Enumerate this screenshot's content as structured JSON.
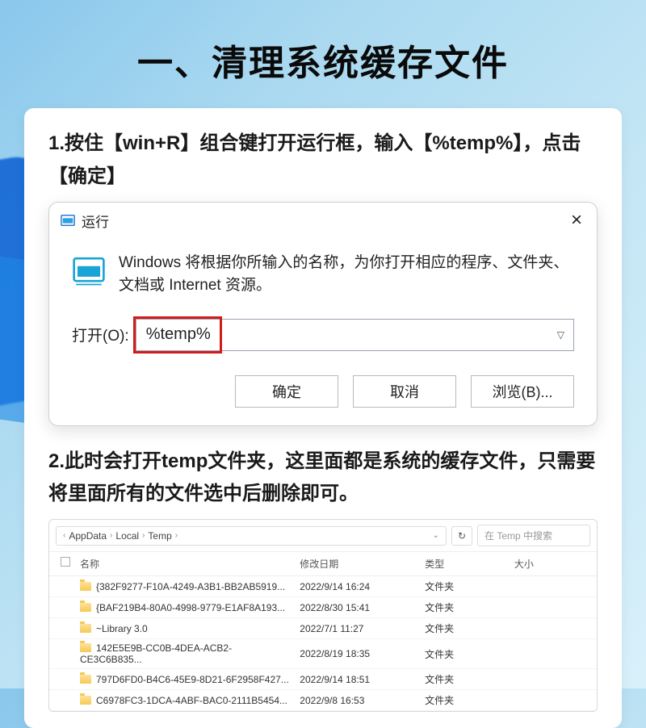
{
  "page_title": "一、清理系统缓存文件",
  "step1": "1.按住【win+R】组合键打开运行框，输入【%temp%】，点击【确定】",
  "step2": "2.此时会打开temp文件夹，这里面都是系统的缓存文件，只需要将里面所有的文件选中后删除即可。",
  "run": {
    "title": "运行",
    "desc": "Windows 将根据你所输入的名称，为你打开相应的程序、文件夹、文档或 Internet 资源。",
    "open_label": "打开(O):",
    "value": "%temp%",
    "ok": "确定",
    "cancel": "取消",
    "browse": "浏览(B)..."
  },
  "explorer": {
    "crumb1": "AppData",
    "crumb2": "Local",
    "crumb3": "Temp",
    "search_placeholder": "在 Temp 中搜索",
    "col_name": "名称",
    "col_date": "修改日期",
    "col_type": "类型",
    "col_size": "大小",
    "rows": [
      {
        "name": "{382F9277-F10A-4249-A3B1-BB2AB5919...",
        "date": "2022/9/14 16:24",
        "type": "文件夹"
      },
      {
        "name": "{BAF219B4-80A0-4998-9779-E1AF8A193...",
        "date": "2022/8/30 15:41",
        "type": "文件夹"
      },
      {
        "name": "~Library 3.0",
        "date": "2022/7/1 11:27",
        "type": "文件夹"
      },
      {
        "name": "142E5E9B-CC0B-4DEA-ACB2-CE3C6B835...",
        "date": "2022/8/19 18:35",
        "type": "文件夹"
      },
      {
        "name": "797D6FD0-B4C6-45E9-8D21-6F2958F427...",
        "date": "2022/9/14 18:51",
        "type": "文件夹"
      },
      {
        "name": "C6978FC3-1DCA-4ABF-BAC0-2111B5454...",
        "date": "2022/9/8 16:53",
        "type": "文件夹"
      }
    ]
  }
}
